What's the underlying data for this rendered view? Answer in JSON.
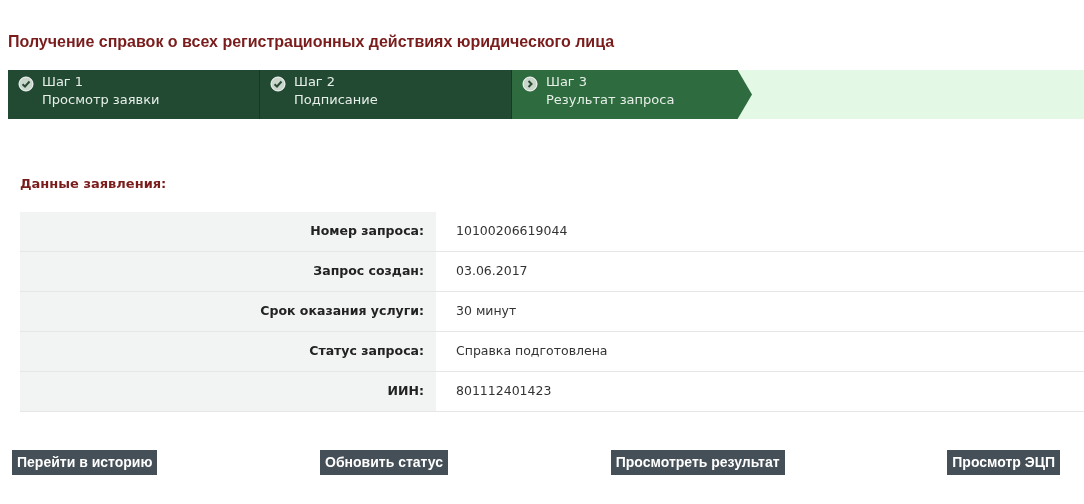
{
  "title": "Получение справок о всех регистрационных действиях юридического лица",
  "steps": [
    {
      "step": "Шаг 1",
      "label": "Просмотр заявки",
      "done": true,
      "selected": false
    },
    {
      "step": "Шаг 2",
      "label": "Подписание",
      "done": true,
      "selected": false
    },
    {
      "step": "Шаг 3",
      "label": "Результат запроса",
      "done": false,
      "selected": true
    }
  ],
  "section_title": "Данные заявления:",
  "fields": [
    {
      "label": "Номер запроса:",
      "value": "10100206619044"
    },
    {
      "label": "Запрос создан:",
      "value": "03.06.2017"
    },
    {
      "label": "Срок оказания услуги:",
      "value": "30 минут"
    },
    {
      "label": "Статус запроса:",
      "value": "Справка подготовлена"
    },
    {
      "label": "ИИН:",
      "value": "801112401423"
    }
  ],
  "buttons": [
    "Перейти в историю",
    "Обновить статус",
    "Просмотреть результат",
    "Просмотр ЭЦП"
  ]
}
